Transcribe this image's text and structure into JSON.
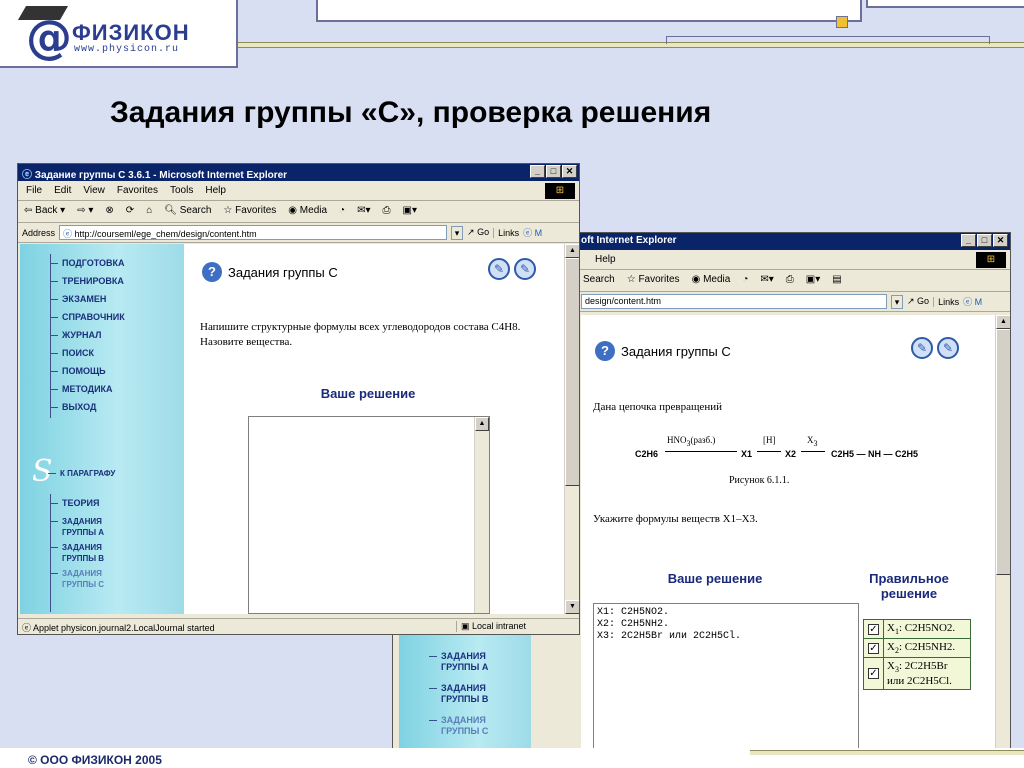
{
  "logo": {
    "name": "ФИЗИКОН",
    "url": "www.physicon.ru"
  },
  "slide": {
    "title": "Задания группы «С», проверка решения"
  },
  "footer": {
    "text": "© ООО ФИЗИКОН 2005"
  },
  "back_window": {
    "title": "oft Internet Explorer",
    "menu": [
      "Help"
    ],
    "toolbar": [
      "Search",
      "Favorites",
      "Media"
    ],
    "address": "design/content.htm",
    "go_label": "Go",
    "links_label": "Links",
    "task_heading": "Задания группы С",
    "intro": "Дана цепочка превращений",
    "scheme": {
      "reagent1": "HNO",
      "reagent1_sub": "3",
      "reagent1_rest": "(разб.)",
      "reagent2": "[H]",
      "reagent3": "X",
      "reagent3_sub": "3",
      "c2h6": "C2H6",
      "x1": "X1",
      "x2": "X2",
      "product": "C2H5 — NH — C2H5"
    },
    "figure_caption": "Рисунок 6.1.1.",
    "question": "Укажите формулы веществ X1–X3.",
    "your_solution": "Ваше решение",
    "correct_solution": "Правильное решение",
    "answer_text": "X1: C2H5NO2.\nX2: C2H5NH2.\nX3: 2C2H5Br или 2C2H5Cl.",
    "correct": [
      {
        "label": "X",
        "sub": "1",
        "rest": ": C2H5NO2."
      },
      {
        "label": "X",
        "sub": "2",
        "rest": ": C2H5NH2."
      },
      {
        "label": "X",
        "sub": "3",
        "rest": ": 2C2H5Br или 2C2H5Cl."
      }
    ],
    "nav_partial": [
      "ЗАДАНИЯ ГРУППЫ А",
      "ЗАДАНИЯ ГРУППЫ В",
      "ЗАДАНИЯ ГРУППЫ С"
    ]
  },
  "front_window": {
    "title": "Задание группы С 3.6.1 - Microsoft Internet Explorer",
    "menu": [
      "File",
      "Edit",
      "View",
      "Favorites",
      "Tools",
      "Help"
    ],
    "toolbar": [
      "Back",
      "Search",
      "Favorites",
      "Media"
    ],
    "address_label": "Address",
    "address": "http://courseml/ege_chem/design/content.htm",
    "go_label": "Go",
    "links_label": "Links",
    "nav_top": [
      "ПОДГОТОВКА",
      "ТРЕНИРОВКА",
      "ЭКЗАМЕН",
      "СПРАВОЧНИК",
      "ЖУРНАЛ",
      "ПОИСК",
      "ПОМОЩЬ",
      "МЕТОДИКА",
      "ВЫХОД"
    ],
    "nav_section": "К ПАРАГРАФУ",
    "nav_bottom": [
      "ТЕОРИЯ",
      "ЗАДАНИЯ ГРУППЫ А",
      "ЗАДАНИЯ ГРУППЫ В",
      "ЗАДАНИЯ ГРУППЫ С"
    ],
    "task_heading": "Задания группы С",
    "task_text": "Напишите структурные формулы всех углеводородов состава C4H8. Назовите вещества.",
    "your_solution": "Ваше решение",
    "status": "Applet physicon.journal2.LocalJournal started",
    "zone": "Local intranet"
  }
}
